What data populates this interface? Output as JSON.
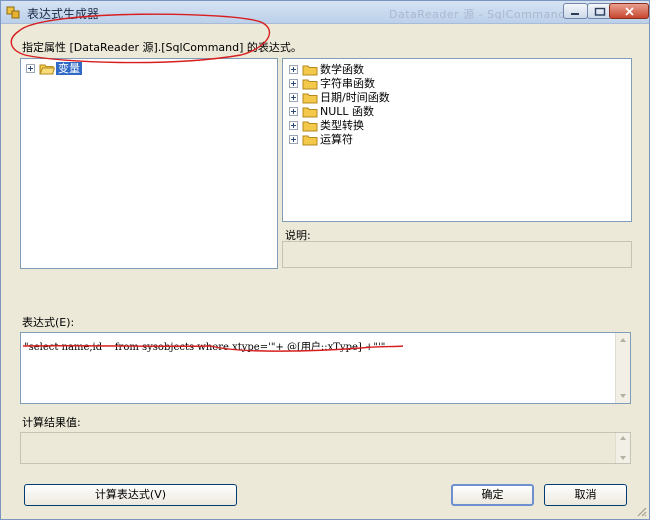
{
  "window": {
    "title": "表达式生成器",
    "ghost_title": "DataReader 源 - SqlCommand",
    "controls": [
      "minimize-icon",
      "maximize-icon",
      "close-icon"
    ]
  },
  "prompt": "指定属性 [DataReader 源].[SqlCommand] 的表达式。",
  "left_tree": {
    "items": [
      {
        "label": "变量",
        "selected": true,
        "icon": "folder-open-icon"
      }
    ]
  },
  "right_tree": {
    "items": [
      {
        "label": "数学函数",
        "icon": "folder-icon"
      },
      {
        "label": "字符串函数",
        "icon": "folder-icon"
      },
      {
        "label": "日期/时间函数",
        "icon": "folder-icon"
      },
      {
        "label": "NULL 函数",
        "icon": "folder-icon"
      },
      {
        "label": "类型转换",
        "icon": "folder-icon"
      },
      {
        "label": "运算符",
        "icon": "folder-icon"
      }
    ]
  },
  "description": {
    "label": "说明:",
    "value": ""
  },
  "expression": {
    "label": "表达式(E):",
    "value": "\"select name,id    from sysobjects where xtype='\"+ @[用户::xType] +\"'\""
  },
  "result": {
    "label": "计算结果值:",
    "value": ""
  },
  "buttons": {
    "evaluate": "计算表达式(V)",
    "ok": "确定",
    "cancel": "取消"
  },
  "colors": {
    "annotation_red": "#d81e1e",
    "selection_blue": "#316ac5",
    "folder_yellow": "#f3c84b"
  }
}
